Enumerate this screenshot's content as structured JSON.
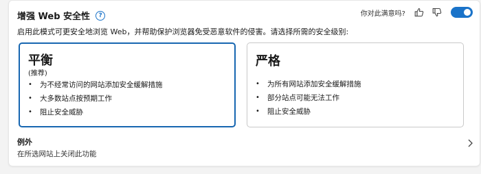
{
  "section": {
    "title": "增强 Web 安全性",
    "subtitle": "启用此模式可更安全地浏览 Web，并帮助保护浏览器免受恶意软件的侵害。请选择所需的安全级别:",
    "help_icon": "?"
  },
  "feedback": {
    "question": "你对此满意吗?",
    "like_icon": "thumbs-up-icon",
    "dislike_icon": "thumbs-down-icon"
  },
  "toggle": {
    "state": "on",
    "color": "#1a73c9"
  },
  "options": [
    {
      "title": "平衡",
      "recommended": "(推荐)",
      "selected": true,
      "items": [
        "为不经常访问的网站添加安全缓解措施",
        "大多数站点按预期工作",
        "阻止安全威胁"
      ]
    },
    {
      "title": "严格",
      "recommended": "",
      "selected": false,
      "items": [
        "为所有网站添加安全缓解措施",
        "部分站点可能无法工作",
        "阻止安全威胁"
      ]
    }
  ],
  "exceptions": {
    "title": "例外",
    "description": "在所选网站上关闭此功能"
  },
  "colors": {
    "accent": "#1a73c9",
    "selected_border": "#1565b0"
  }
}
